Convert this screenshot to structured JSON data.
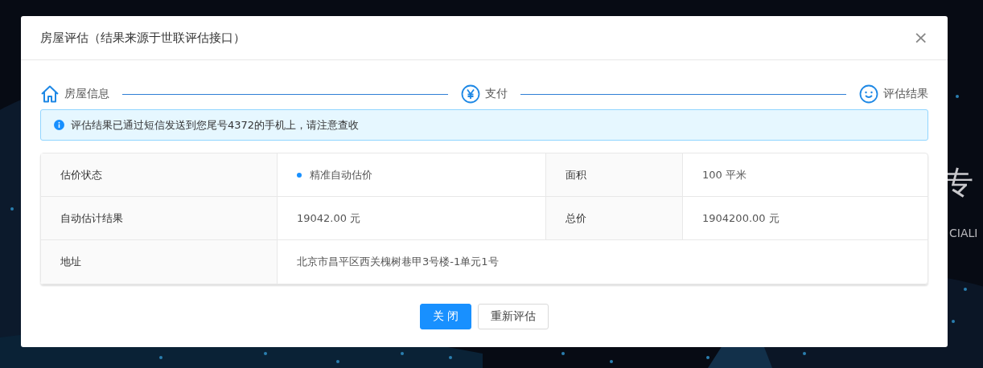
{
  "background": {
    "kind": "picture",
    "heading": "专",
    "subheading": "CIALI"
  },
  "dialog": {
    "title": "房屋评估（结果来源于世联评估接口）",
    "close": "×",
    "steps": [
      {
        "kind": "home",
        "label": "房屋信息"
      },
      {
        "kind": "yen",
        "label": "支付"
      },
      {
        "kind": "smile",
        "label": "评估结果"
      }
    ],
    "alert": {
      "text": "评估结果已通过短信发送到您尾号4372的手机上，请注意查收"
    },
    "table": {
      "rows": [
        [
          {
            "label": "估价状态",
            "value": "精准自动估价",
            "color": "#1890ff"
          },
          {
            "label": "面积",
            "value": "100 平米"
          }
        ],
        [
          {
            "label": "自动估计结果",
            "value": "19042.00 元"
          },
          {
            "label": "总价",
            "value": "1904200.00 元"
          }
        ],
        [
          {
            "label": "地址",
            "value": "北京市昌平区西关槐树巷甲3号楼-1单元1号"
          }
        ]
      ]
    },
    "buttons": [
      {
        "kind": "primary",
        "label": "关 闭"
      },
      {
        "kind": "default",
        "label": "重新评估"
      }
    ]
  }
}
